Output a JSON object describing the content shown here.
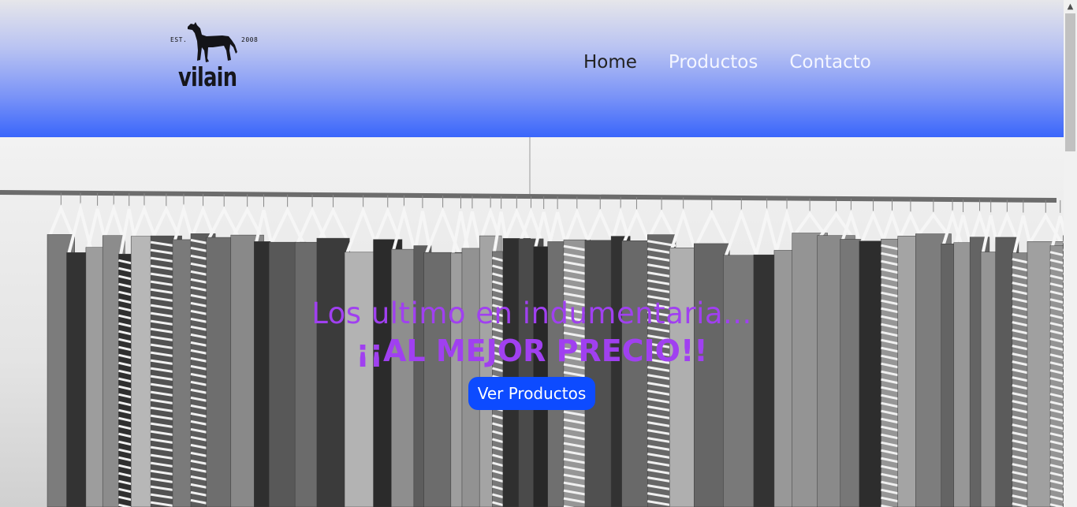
{
  "logo": {
    "est": "EST.",
    "year": "2008",
    "brand": "vilain",
    "icon": "dog-silhouette-icon"
  },
  "nav": {
    "items": [
      {
        "label": "Home"
      },
      {
        "label": "Productos"
      },
      {
        "label": "Contacto"
      }
    ]
  },
  "hero": {
    "headline": "Los ultimo en indumentaria...",
    "subline": "¡¡AL MEJOR PRECIO!!",
    "cta_label": "Ver Productos",
    "background": "clothes-rack-photo"
  },
  "colors": {
    "header_gradient_top": "#e6e6ea",
    "header_gradient_bottom": "#3a66fb",
    "headline": "#a040f0",
    "cta_background": "#0d4bff",
    "nav_active": "#222222",
    "nav_inactive": "#f4f6ff"
  }
}
